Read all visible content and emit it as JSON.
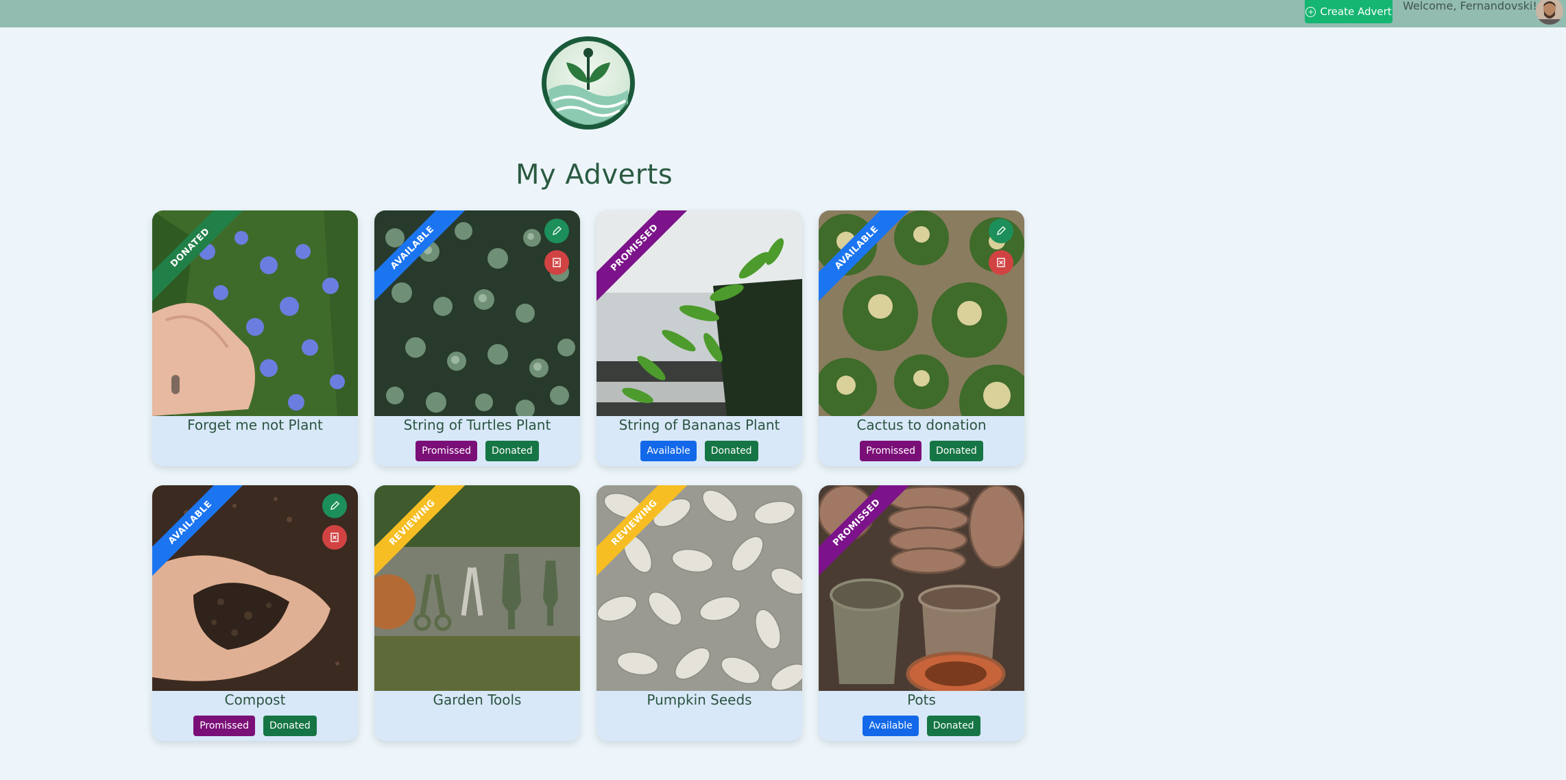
{
  "header": {
    "create_label": "Create Advert",
    "welcome_text": "Welcome, Fernandovski!"
  },
  "page": {
    "title": "My Adverts"
  },
  "colors": {
    "primary_green": "#15b572",
    "topbar": "#93bcb1",
    "promissed": "#7b0f78",
    "donated": "#167545",
    "available": "#1268e8",
    "reviewing": "#f6be22"
  },
  "adverts": [
    {
      "title": "Forget me not Plant",
      "status": "DONATED",
      "buttons": []
    },
    {
      "title": "String of Turtles Plant",
      "status": "AVAILABLE",
      "buttons": [
        "Promissed",
        "Donated"
      ]
    },
    {
      "title": "String of Bananas Plant",
      "status": "PROMISSED",
      "buttons": [
        "Available",
        "Donated"
      ]
    },
    {
      "title": "Cactus to donation",
      "status": "AVAILABLE",
      "buttons": [
        "Promissed",
        "Donated"
      ]
    },
    {
      "title": "Compost",
      "status": "AVAILABLE",
      "buttons": [
        "Promissed",
        "Donated"
      ]
    },
    {
      "title": "Garden Tools",
      "status": "REVIEWING",
      "buttons": []
    },
    {
      "title": "Pumpkin Seeds",
      "status": "REVIEWING",
      "buttons": []
    },
    {
      "title": "Pots",
      "status": "PROMISSED",
      "buttons": [
        "Available",
        "Donated"
      ]
    }
  ]
}
